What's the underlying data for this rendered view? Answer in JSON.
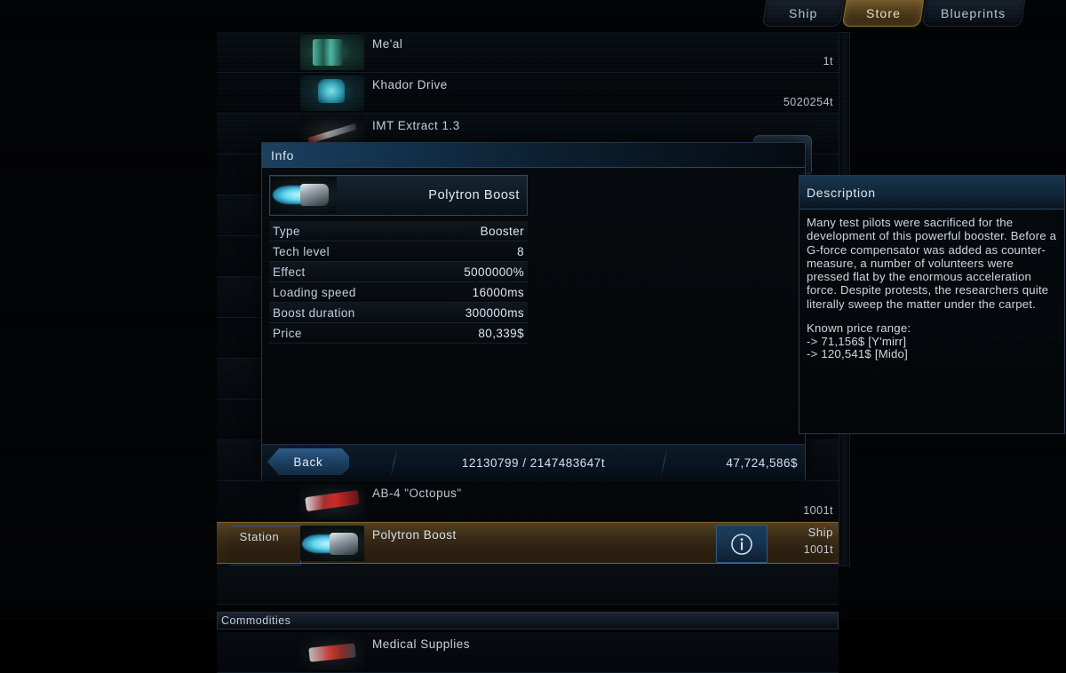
{
  "tabs": [
    {
      "label": "Ship",
      "active": false
    },
    {
      "label": "Store",
      "active": true
    },
    {
      "label": "Blueprints",
      "active": false
    }
  ],
  "list": {
    "items": [
      {
        "name": "Me'al",
        "qty": "1t",
        "thumb": "meal-icon"
      },
      {
        "name": "Khador Drive",
        "qty": "5020254t",
        "thumb": "khador-drive-icon"
      },
      {
        "name": "IMT Extract 1.3",
        "qty": "",
        "thumb": "imt-extract-icon"
      }
    ],
    "lower_items": [
      {
        "name": "AB-4 \"Octopus\"",
        "qty": "1001t",
        "thumb": "octopus-icon"
      }
    ],
    "selected": {
      "station_label": "Station",
      "name": "Polytron Boost",
      "ship_label": "Ship",
      "ship_qty": "1001t",
      "info_icon": "info-circle-icon",
      "thumb": "polytron-boost-icon"
    },
    "section_header": "Commodities",
    "commodity_items": [
      {
        "name": "Medical Supplies",
        "qty": "",
        "thumb": "medical-supplies-icon"
      }
    ]
  },
  "help_button": {
    "icon": "question-circle-icon"
  },
  "info_panel": {
    "title": "Info",
    "item": {
      "name": "Polytron Boost",
      "thumb": "polytron-boost-icon"
    },
    "stats": [
      {
        "key": "Type",
        "value": "Booster"
      },
      {
        "key": "Tech level",
        "value": "8"
      },
      {
        "key": "Effect",
        "value": "5000000%"
      },
      {
        "key": "Loading speed",
        "value": "16000ms"
      },
      {
        "key": "Boost duration",
        "value": "300000ms"
      },
      {
        "key": "Price",
        "value": "80,339$"
      }
    ],
    "description": {
      "title": "Description",
      "body": "Many test pilots were sacrificed for the development of this powerful booster. Before a G-force compensator was added as counter-measure, a number of volunteers were pressed flat by the enormous acceleration force. Despite protests, the researchers quite literally sweep the matter under the carpet.",
      "price_range": "Known price range:\n-> 71,156$ [Y'mirr]\n-> 120,541$ [Mido]"
    },
    "footer": {
      "back_label": "Back",
      "cargo": "12130799 / 2147483647t",
      "credits": "47,724,586$"
    }
  },
  "colors": {
    "accent_blue": "#2d5a86",
    "accent_amber": "#8e7134",
    "text": "#c9d4dc"
  }
}
